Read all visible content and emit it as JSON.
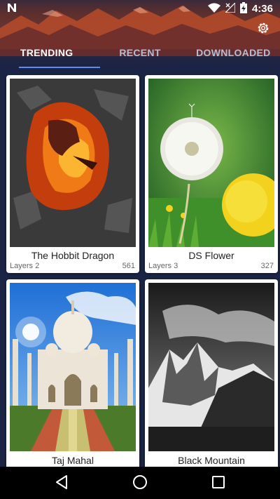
{
  "status_bar": {
    "time": "4:36",
    "left_icon": "notification-n-icon",
    "icons": [
      "wifi-icon",
      "signal-off-icon",
      "battery-charging-icon"
    ]
  },
  "header": {
    "settings_icon": "gear-icon"
  },
  "tabs": [
    {
      "label": "TRENDING",
      "active": true
    },
    {
      "label": "RECENT",
      "active": false
    },
    {
      "label": "DOWNLOADED",
      "active": false
    }
  ],
  "cards": [
    {
      "title": "The Hobbit Dragon",
      "layers": "Layers 2",
      "count": "561",
      "image": "dragon-in-cave"
    },
    {
      "title": "DS Flower",
      "layers": "Layers 3",
      "count": "327",
      "image": "dandelion"
    },
    {
      "title": "Taj Mahal",
      "layers": "",
      "count": "",
      "image": "taj-mahal"
    },
    {
      "title": "Black Mountain",
      "layers": "",
      "count": "",
      "image": "snowy-mountain-bw"
    }
  ],
  "nav": {
    "back_icon": "back-triangle-icon",
    "home_icon": "home-circle-icon",
    "recents_icon": "recents-square-icon"
  },
  "colors": {
    "background": "#1b2444",
    "tab_indicator": "#5a8dee",
    "card": "#ffffff"
  }
}
